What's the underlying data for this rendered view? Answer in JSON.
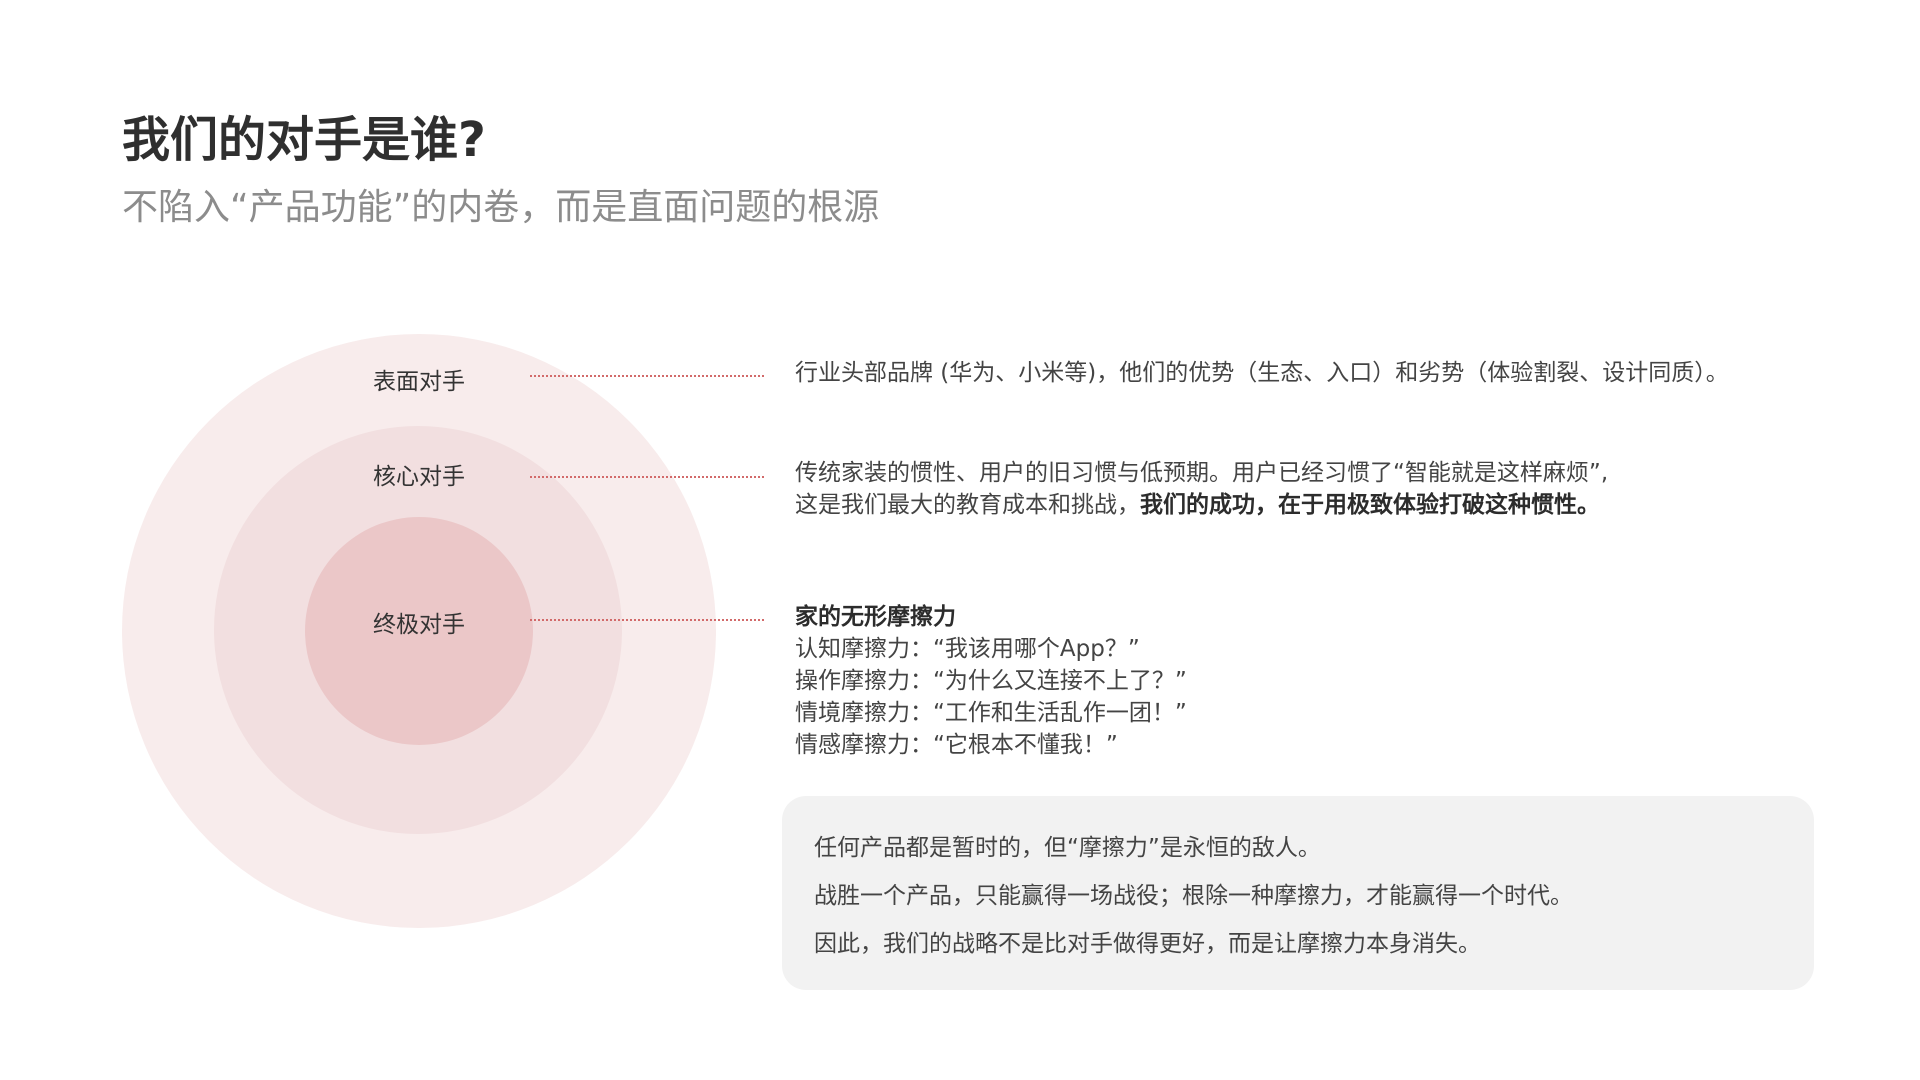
{
  "header": {
    "title": "我们的对手是谁?",
    "subtitle": "不陷入“产品功能”的内卷，而是直面问题的根源"
  },
  "diagram": {
    "rings": [
      {
        "label": "表面对手",
        "description": {
          "lines": [
            "行业头部品牌 (华为、小米等)，他们的优势（生态、入口）和劣势（体验割裂、设计同质）。"
          ]
        }
      },
      {
        "label": "核心对手",
        "description": {
          "line1": "传统家装的惯性、用户的旧习惯与低预期。用户已经习惯了“智能就是这样麻烦”,",
          "line2_normal": "这是我们最大的教育成本和挑战，",
          "line2_bold": "我们的成功，在于用极致体验打破这种惯性。"
        }
      },
      {
        "label": "终极对手",
        "description": {
          "heading": "家的无形摩擦力",
          "items": [
            "认知摩擦力：“我该用哪个App？”",
            "操作摩擦力：“为什么又连接不上了？”",
            "情境摩擦力：“工作和生活乱作一团！”",
            "情感摩擦力：“它根本不懂我！”"
          ]
        }
      }
    ],
    "colors": {
      "outer_ring": "#f8ecec",
      "middle_ring": "#f2dfe0",
      "inner_ring": "#ebc7c8",
      "connector": "#d26a6a"
    }
  },
  "quote_box": {
    "lines": [
      "任何产品都是暂时的，但“摩擦力”是永恒的敌人。",
      "战胜一个产品，只能赢得一场战役；根除一种摩擦力，才能赢得一个时代。",
      "因此，我们的战略不是比对手做得更好，而是让摩擦力本身消失。"
    ]
  }
}
